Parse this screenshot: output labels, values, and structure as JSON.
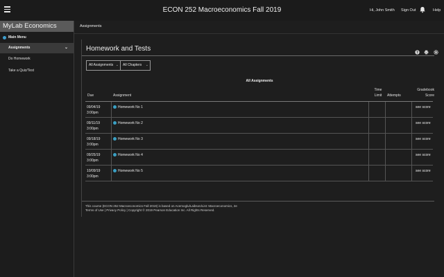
{
  "topbar": {
    "course_title": "ECON 252 Macroeconomics Fall 2019",
    "user_greeting": "Hi, John Smith",
    "signout_label": "Sign Out",
    "help_label": "Help"
  },
  "sidebar": {
    "brand": "MyLab Economics",
    "main_menu": "Main Menu",
    "active_item": "Assignments",
    "items": [
      {
        "label": "Do Homework"
      },
      {
        "label": "Take a Quiz/Test"
      }
    ]
  },
  "breadcrumb": "Assignments",
  "page": {
    "title": "Homework and Tests",
    "filter_assignments": "All Assignments",
    "filter_chapters": "All Chapters",
    "table_caption": "All Assignments"
  },
  "table": {
    "headers": {
      "due": "Due",
      "assignment": "Assignment",
      "time_limit_1": "Time",
      "time_limit_2": "Limit",
      "attempts": "Attempts",
      "score_1": "Gradebook",
      "score_2": "Score"
    },
    "rows": [
      {
        "date": "09/04/19",
        "time": "3:00pm",
        "name": "Homework No 1",
        "score": "see score"
      },
      {
        "date": "09/11/19",
        "time": "3:00pm",
        "name": "Homework No 2",
        "score": "see score"
      },
      {
        "date": "09/18/19",
        "time": "3:00pm",
        "name": "Homework No 3",
        "score": "see score"
      },
      {
        "date": "09/25/19",
        "time": "3:00pm",
        "name": "Homework No 4",
        "score": "see score"
      },
      {
        "date": "10/09/19",
        "time": "3:00pm",
        "name": "Homework No 5",
        "score": "see score"
      }
    ]
  },
  "footer": {
    "line1": "This course (ECON 252 Macroeconomics Fall 2019) is based on Acemoglu/Laibson/List: Macroeconomics, 2e",
    "terms": "Terms of Use",
    "privacy": "Privacy Policy",
    "copyright": "Copyright © 2019 Pearson Education Inc. All Rights Reserved."
  },
  "colors": {
    "background": "#1e1e1e",
    "brand_bar": "#5a5a5a",
    "active_item": "#3a3a3a",
    "status_dot": "#3aa0c4"
  },
  "icons": {
    "menu": "hamburger-icon",
    "notifications": "bell-icon",
    "help_tool": "question-icon",
    "print_tool": "printer-icon",
    "settings_tool": "gear-icon"
  }
}
